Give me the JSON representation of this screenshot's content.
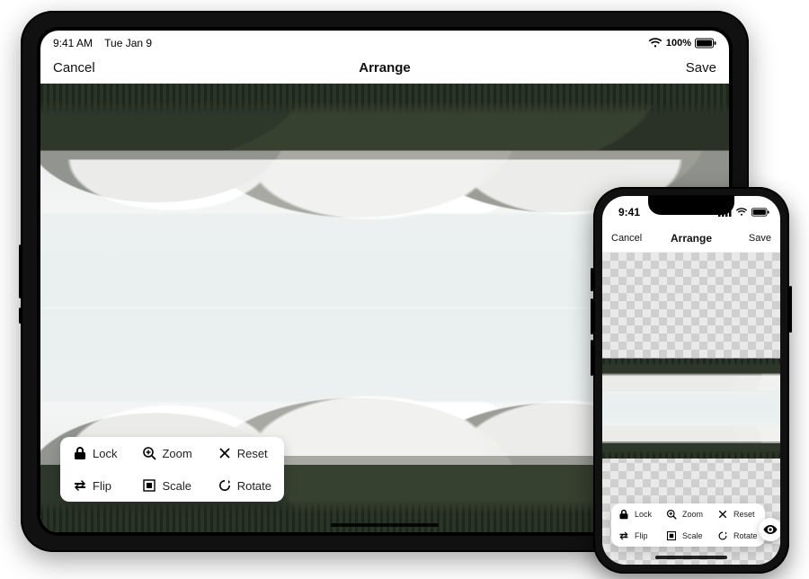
{
  "ipad": {
    "status": {
      "time": "9:41 AM",
      "date": "Tue Jan 9",
      "battery": "100%"
    },
    "nav": {
      "cancel": "Cancel",
      "title": "Arrange",
      "save": "Save"
    },
    "tools": {
      "lock": {
        "label": "Lock",
        "icon": "lock-icon"
      },
      "zoom": {
        "label": "Zoom",
        "icon": "zoom-in-icon"
      },
      "reset": {
        "label": "Reset",
        "icon": "x-icon"
      },
      "flip": {
        "label": "Flip",
        "icon": "swap-icon"
      },
      "scale": {
        "label": "Scale",
        "icon": "scale-icon"
      },
      "rotate": {
        "label": "Rotate",
        "icon": "rotate-icon"
      }
    }
  },
  "iphone": {
    "status": {
      "time": "9:41"
    },
    "nav": {
      "cancel": "Cancel",
      "title": "Arrange",
      "save": "Save"
    },
    "tools": {
      "lock": {
        "label": "Lock",
        "icon": "lock-icon"
      },
      "zoom": {
        "label": "Zoom",
        "icon": "zoom-in-icon"
      },
      "reset": {
        "label": "Reset",
        "icon": "x-icon"
      },
      "flip": {
        "label": "Flip",
        "icon": "swap-icon"
      },
      "scale": {
        "label": "Scale",
        "icon": "scale-icon"
      },
      "rotate": {
        "label": "Rotate",
        "icon": "rotate-icon"
      }
    },
    "preview_icon": "eye-icon"
  }
}
